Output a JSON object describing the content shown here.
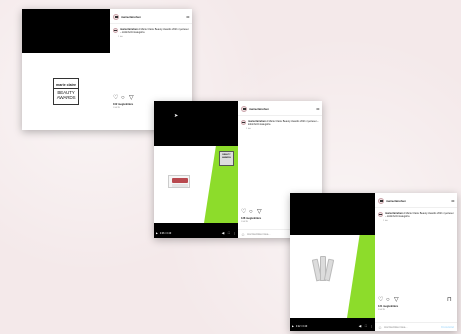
{
  "account": {
    "handle": "marieclairehun"
  },
  "caption_text": "A Marie Claire Beauty Awards 2021 nyertesei – különböző kategória",
  "time_ago": "1 hét",
  "post1": {
    "likes": "102 megtekintés",
    "date": "1 HETE",
    "logo": {
      "brand": "marie claire",
      "line1": "BEAUTY",
      "line2": "AWARDS"
    }
  },
  "post2": {
    "likes": "128 megtekintés",
    "date": "1 HETE",
    "video_time": "0:06 / 0:49",
    "progress": 0.12,
    "comment_placeholder": "Hozzászólás írása...",
    "award_badge": "BEAUTY AWARDS"
  },
  "post3": {
    "likes": "121 megtekintés",
    "date": "1 HETE",
    "video_time": "0:22 / 0:49",
    "progress": 0.45,
    "comment_placeholder": "Hozzászólás írása...",
    "post_label": "Közzététel"
  },
  "icons": {
    "heart": "heart-icon",
    "comment": "comment-icon",
    "share": "share-icon",
    "save": "bookmark-icon",
    "more": "more-icon",
    "play": "play-icon",
    "volume": "volume-icon",
    "fullscreen": "fullscreen-icon",
    "emoji": "emoji-icon"
  },
  "colors": {
    "green": "#8ddc2b",
    "background": "#f4e9ea",
    "link": "#b2dffc"
  }
}
